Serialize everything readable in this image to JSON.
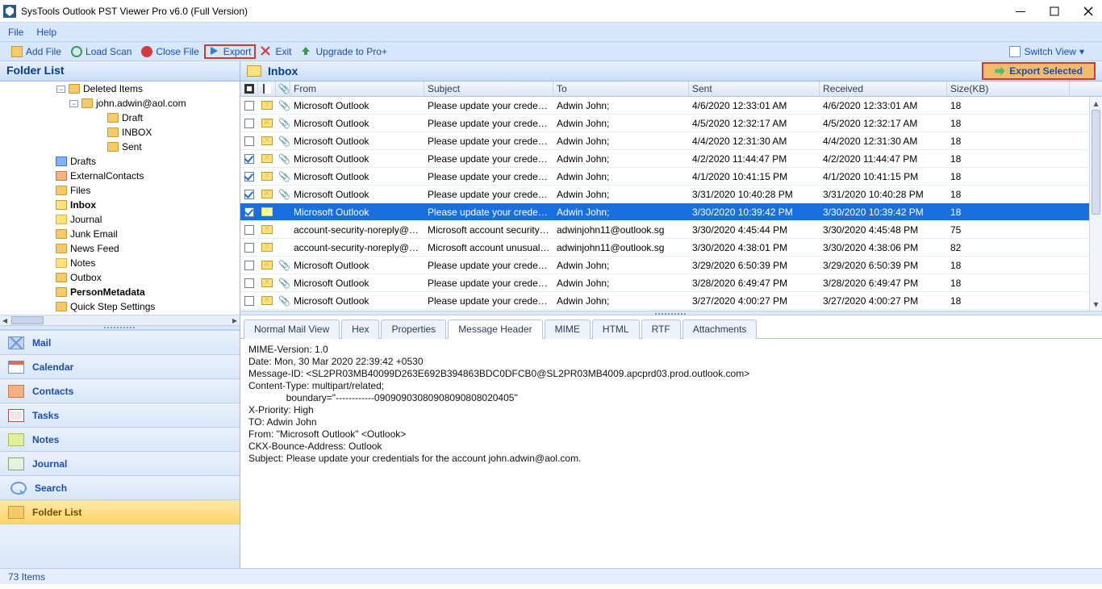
{
  "title": "SysTools Outlook PST Viewer Pro v6.0 (Full Version)",
  "menu": {
    "file": "File",
    "help": "Help"
  },
  "toolbar": {
    "add_file": "Add File",
    "load_scan": "Load Scan",
    "close_file": "Close File",
    "export": "Export",
    "exit": "Exit",
    "upgrade": "Upgrade to Pro+",
    "switch_view": "Switch View"
  },
  "folder_panel": {
    "header": "Folder List",
    "tree": [
      {
        "indent": 4,
        "twisty": "−",
        "icon": "folder",
        "label": "Deleted Items"
      },
      {
        "indent": 5,
        "twisty": "−",
        "icon": "folder",
        "label": "john.adwin@aol.com"
      },
      {
        "indent": 7,
        "twisty": "",
        "icon": "folder",
        "label": "Draft"
      },
      {
        "indent": 7,
        "twisty": "",
        "icon": "folder",
        "label": "INBOX"
      },
      {
        "indent": 7,
        "twisty": "",
        "icon": "folder",
        "label": "Sent"
      },
      {
        "indent": 3,
        "twisty": "",
        "icon": "folder-blue",
        "label": "Drafts"
      },
      {
        "indent": 3,
        "twisty": "",
        "icon": "contact",
        "label": "ExternalContacts"
      },
      {
        "indent": 3,
        "twisty": "",
        "icon": "folder",
        "label": "Files"
      },
      {
        "indent": 3,
        "twisty": "",
        "icon": "inbox",
        "label": "Inbox",
        "bold": true
      },
      {
        "indent": 3,
        "twisty": "",
        "icon": "note",
        "label": "Journal"
      },
      {
        "indent": 3,
        "twisty": "",
        "icon": "folder",
        "label": "Junk Email"
      },
      {
        "indent": 3,
        "twisty": "",
        "icon": "folder",
        "label": "News Feed"
      },
      {
        "indent": 3,
        "twisty": "",
        "icon": "note",
        "label": "Notes"
      },
      {
        "indent": 3,
        "twisty": "",
        "icon": "folder",
        "label": "Outbox"
      },
      {
        "indent": 3,
        "twisty": "",
        "icon": "folder",
        "label": "PersonMetadata",
        "bold": true
      },
      {
        "indent": 3,
        "twisty": "",
        "icon": "folder",
        "label": "Quick Step Settings"
      }
    ]
  },
  "nav": {
    "items": [
      {
        "icon": "mail",
        "label": "Mail"
      },
      {
        "icon": "cal",
        "label": "Calendar"
      },
      {
        "icon": "contacts",
        "label": "Contacts"
      },
      {
        "icon": "tasks",
        "label": "Tasks"
      },
      {
        "icon": "notes",
        "label": "Notes"
      },
      {
        "icon": "journal",
        "label": "Journal"
      },
      {
        "icon": "search",
        "label": "Search"
      },
      {
        "icon": "folder",
        "label": "Folder List",
        "active": true
      }
    ]
  },
  "messages": {
    "title": "Inbox",
    "export_selected": "Export Selected",
    "columns": {
      "from": "From",
      "subject": "Subject",
      "to": "To",
      "sent": "Sent",
      "received": "Received",
      "size": "Size(KB)"
    },
    "rows": [
      {
        "chk": false,
        "att": true,
        "from": "Microsoft Outlook",
        "subject": "Please update your credenti...",
        "to": "Adwin John;",
        "sent": "4/6/2020 12:33:01 AM",
        "recv": "4/6/2020 12:33:01 AM",
        "size": "18"
      },
      {
        "chk": false,
        "att": true,
        "from": "Microsoft Outlook",
        "subject": "Please update your credenti...",
        "to": "Adwin John;",
        "sent": "4/5/2020 12:32:17 AM",
        "recv": "4/5/2020 12:32:17 AM",
        "size": "18"
      },
      {
        "chk": false,
        "att": true,
        "from": "Microsoft Outlook",
        "subject": "Please update your credenti...",
        "to": "Adwin John;",
        "sent": "4/4/2020 12:31:30 AM",
        "recv": "4/4/2020 12:31:30 AM",
        "size": "18"
      },
      {
        "chk": true,
        "att": true,
        "from": "Microsoft Outlook",
        "subject": "Please update your credenti...",
        "to": "Adwin John;",
        "sent": "4/2/2020 11:44:47 PM",
        "recv": "4/2/2020 11:44:47 PM",
        "size": "18"
      },
      {
        "chk": true,
        "att": true,
        "from": "Microsoft Outlook",
        "subject": "Please update your credenti...",
        "to": "Adwin John;",
        "sent": "4/1/2020 10:41:15 PM",
        "recv": "4/1/2020 10:41:15 PM",
        "size": "18"
      },
      {
        "chk": true,
        "att": true,
        "from": "Microsoft Outlook",
        "subject": "Please update your credenti...",
        "to": "Adwin John;",
        "sent": "3/31/2020 10:40:28 PM",
        "recv": "3/31/2020 10:40:28 PM",
        "size": "18"
      },
      {
        "chk": true,
        "att": false,
        "from": "Microsoft Outlook",
        "subject": "Please update your credenti...",
        "to": "Adwin John;",
        "sent": "3/30/2020 10:39:42 PM",
        "recv": "3/30/2020 10:39:42 PM",
        "size": "18",
        "selected": true
      },
      {
        "chk": false,
        "att": false,
        "from": "account-security-noreply@a...",
        "subject": "Microsoft account security i...",
        "to": "adwinjohn11@outlook.sg",
        "sent": "3/30/2020 4:45:44 PM",
        "recv": "3/30/2020 4:45:48 PM",
        "size": "75"
      },
      {
        "chk": false,
        "att": false,
        "from": "account-security-noreply@a...",
        "subject": "Microsoft account unusual s...",
        "to": "adwinjohn11@outlook.sg",
        "sent": "3/30/2020 4:38:01 PM",
        "recv": "3/30/2020 4:38:06 PM",
        "size": "82"
      },
      {
        "chk": false,
        "att": true,
        "from": "Microsoft Outlook",
        "subject": "Please update your credenti...",
        "to": "Adwin John;",
        "sent": "3/29/2020 6:50:39 PM",
        "recv": "3/29/2020 6:50:39 PM",
        "size": "18"
      },
      {
        "chk": false,
        "att": true,
        "from": "Microsoft Outlook",
        "subject": "Please update your credenti...",
        "to": "Adwin John;",
        "sent": "3/28/2020 6:49:47 PM",
        "recv": "3/28/2020 6:49:47 PM",
        "size": "18"
      },
      {
        "chk": false,
        "att": true,
        "from": "Microsoft Outlook",
        "subject": "Please update your credenti...",
        "to": "Adwin John;",
        "sent": "3/27/2020 4:00:27 PM",
        "recv": "3/27/2020 4:00:27 PM",
        "size": "18"
      }
    ]
  },
  "tabs": {
    "items": [
      "Normal Mail View",
      "Hex",
      "Properties",
      "Message Header",
      "MIME",
      "HTML",
      "RTF",
      "Attachments"
    ],
    "active_index": 3
  },
  "preview": "MIME-Version: 1.0\nDate: Mon, 30 Mar 2020 22:39:42 +0530\nMessage-ID: <SL2PR03MB40099D263E692B394863BDC0DFCB0@SL2PR03MB4009.apcprd03.prod.outlook.com>\nContent-Type: multipart/related;\n              boundary=\"------------09090903080908090808020405\"\nX-Priority: High\nTO: Adwin John\nFrom: \"Microsoft Outlook\" <Outlook>\nCKX-Bounce-Address: Outlook\nSubject: Please update your credentials for the account john.adwin@aol.com.",
  "status": "73 Items"
}
